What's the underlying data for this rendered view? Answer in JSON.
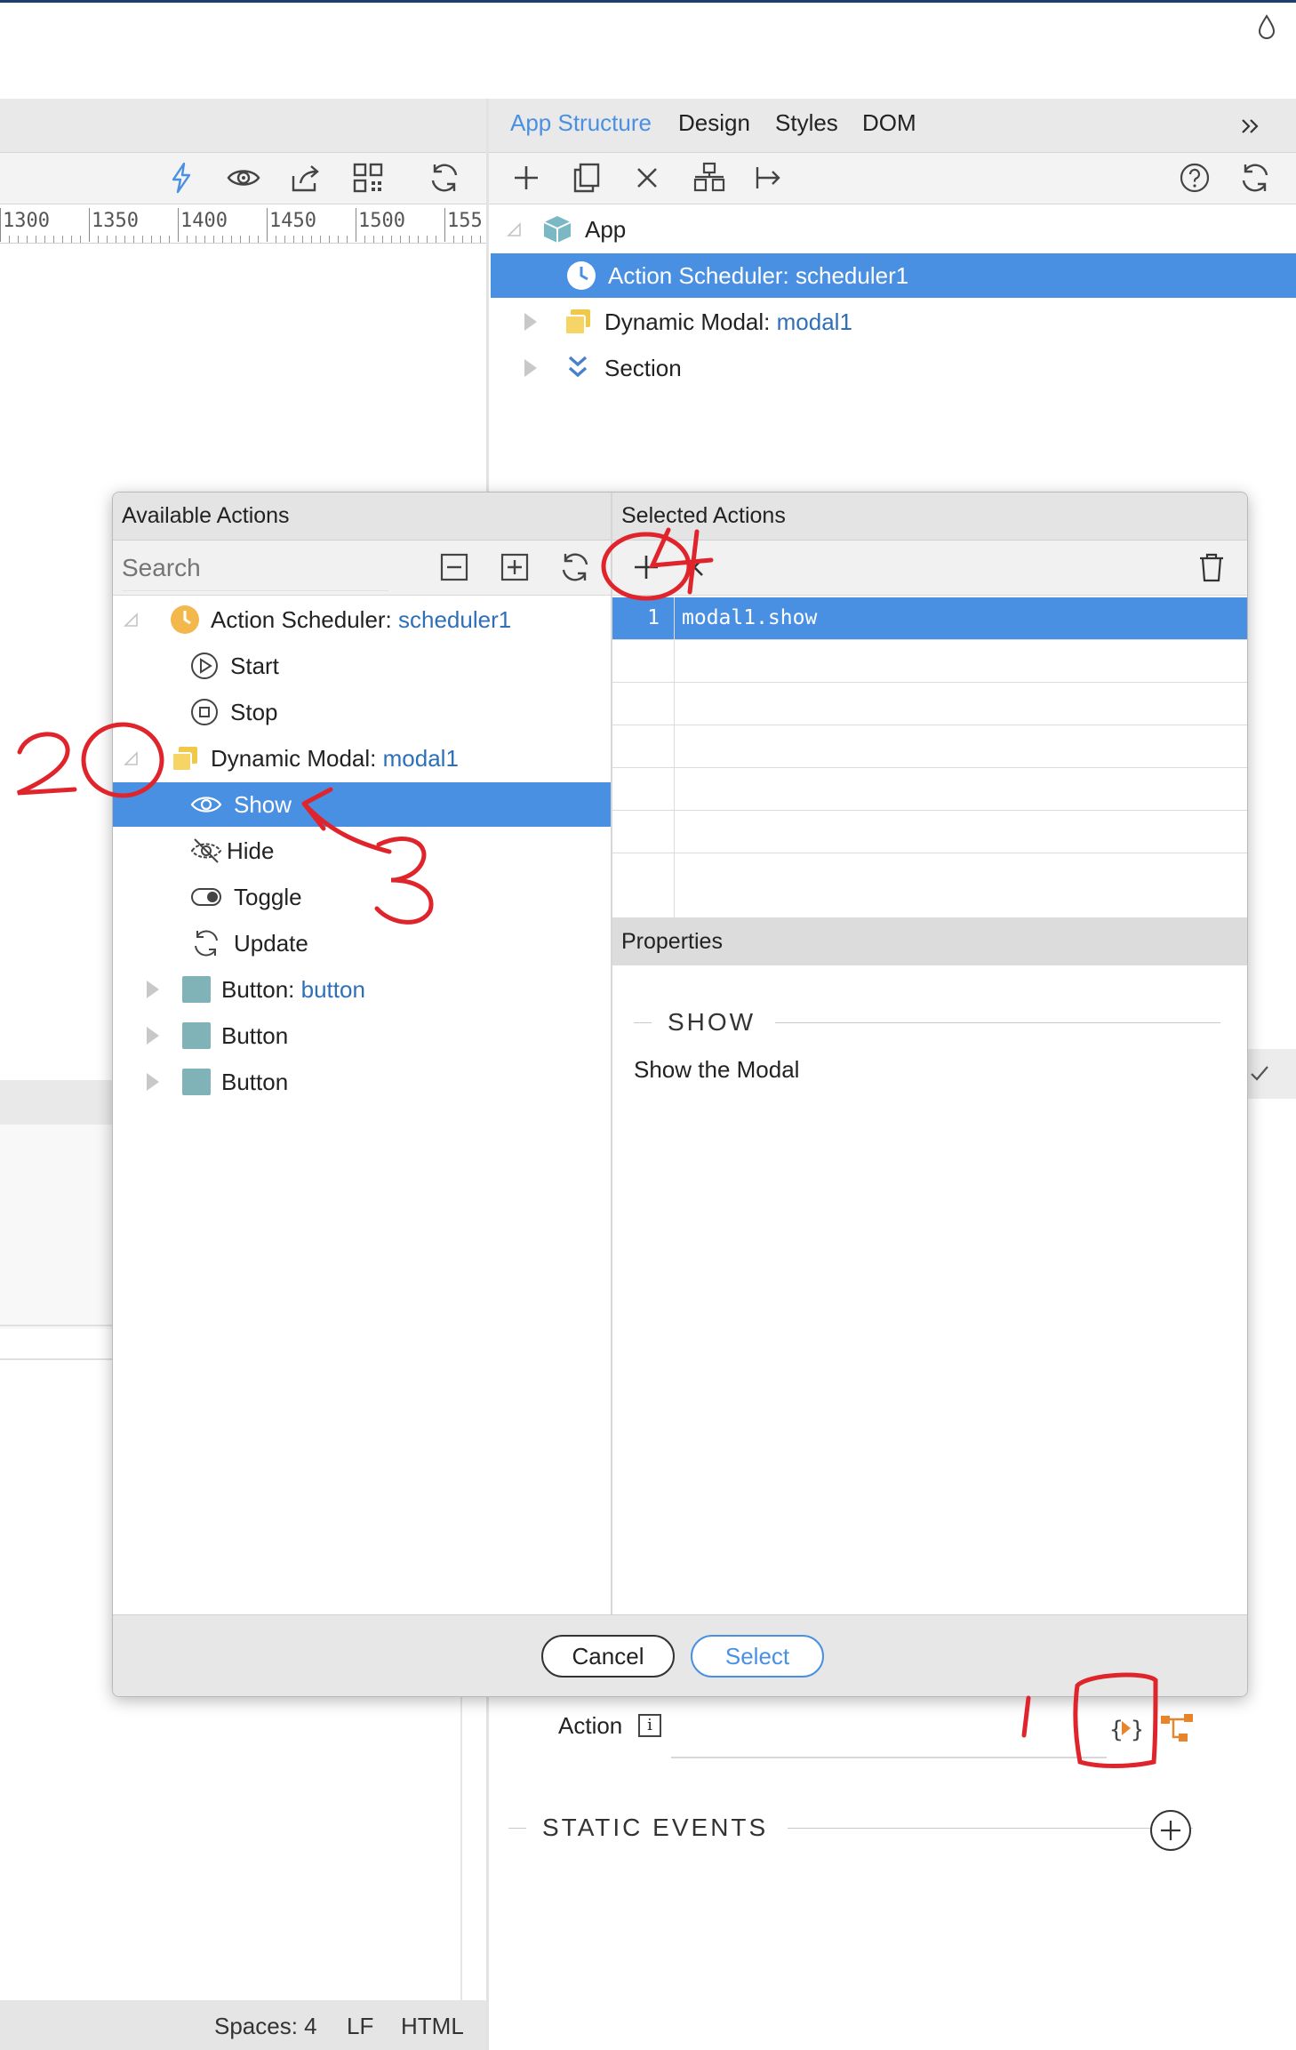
{
  "panel_tabs": [
    "App Structure",
    "Design",
    "Styles",
    "DOM"
  ],
  "panel_tabs_active": 0,
  "ruler_labels": [
    "1300",
    "1350",
    "1400",
    "1450",
    "1500",
    "155"
  ],
  "app_tree": {
    "root": "App",
    "items": [
      {
        "prefix": "Action Scheduler: ",
        "id": "scheduler1",
        "selected": true
      },
      {
        "prefix": "Dynamic Modal: ",
        "id": "modal1",
        "selected": false
      },
      {
        "prefix": "Section",
        "id": "",
        "selected": false
      }
    ]
  },
  "dialog": {
    "available_title": "Available Actions",
    "selected_title": "Selected Actions",
    "search_placeholder": "Search",
    "tree": [
      {
        "prefix": "Action Scheduler: ",
        "id": "scheduler1",
        "level": 0,
        "expanded": true
      },
      {
        "label": "Start",
        "level": 1
      },
      {
        "label": "Stop",
        "level": 1
      },
      {
        "prefix": "Dynamic Modal: ",
        "id": "modal1",
        "level": 0,
        "expanded": true
      },
      {
        "label": "Show",
        "level": 1,
        "selected": true
      },
      {
        "label": "Hide",
        "level": 1
      },
      {
        "label": "Toggle",
        "level": 1
      },
      {
        "label": "Update",
        "level": 1
      },
      {
        "prefix": "Button: ",
        "id": "button",
        "level": 0
      },
      {
        "prefix": "Button",
        "id": "",
        "level": 0
      },
      {
        "prefix": "Button",
        "id": "",
        "level": 0
      }
    ],
    "selected_actions": [
      {
        "num": "1",
        "value": "modal1.show"
      }
    ],
    "properties_title": "Properties",
    "show_heading": "SHOW",
    "show_description": "Show the Modal",
    "cancel_label": "Cancel",
    "select_label": "Select"
  },
  "behind": {
    "action_label": "Action",
    "action_info": "i",
    "static_events": "STATIC EVENTS"
  },
  "status_bar": {
    "spaces": "Spaces: 4",
    "eol": "LF",
    "lang": "HTML"
  },
  "annotations": [
    "1",
    "2",
    "3",
    "4"
  ],
  "colors": {
    "accent": "#4a90e2",
    "annotation": "#e0242b",
    "scheduler": "#f2b84b",
    "modal": "#f0c94a",
    "button": "#7fb3b8",
    "orange": "#e8852a"
  }
}
